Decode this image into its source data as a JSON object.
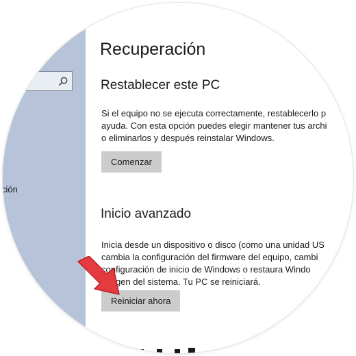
{
  "sidebar": {
    "search": {
      "placeholder": "",
      "icon": "search-icon"
    },
    "items": [
      {
        "label": "ción"
      }
    ]
  },
  "page": {
    "title": "Recuperación"
  },
  "sections": [
    {
      "title": "Restablecer este PC",
      "lines": [
        "Si el equipo no se ejecuta correctamente, restablecerlo p",
        "ayuda. Con esta opción puedes elegir mantener tus archi",
        "o eliminarlos y después reinstalar Windows."
      ],
      "button": "Comenzar"
    },
    {
      "title": "Inicio avanzado",
      "lines": [
        "Inicia desde un dispositivo o disco (como una unidad US",
        "cambia la configuración del firmware del equipo, cambi",
        "configuración de inicio de Windows o restaura Windo",
        "imagen del sistema. Tu PC se reiniciará."
      ],
      "button": "Reiniciar ahora"
    }
  ],
  "colors": {
    "sidebar_bg": "#b7c3d9",
    "button_bg": "#cccccc",
    "arrow": "#e53a40"
  }
}
